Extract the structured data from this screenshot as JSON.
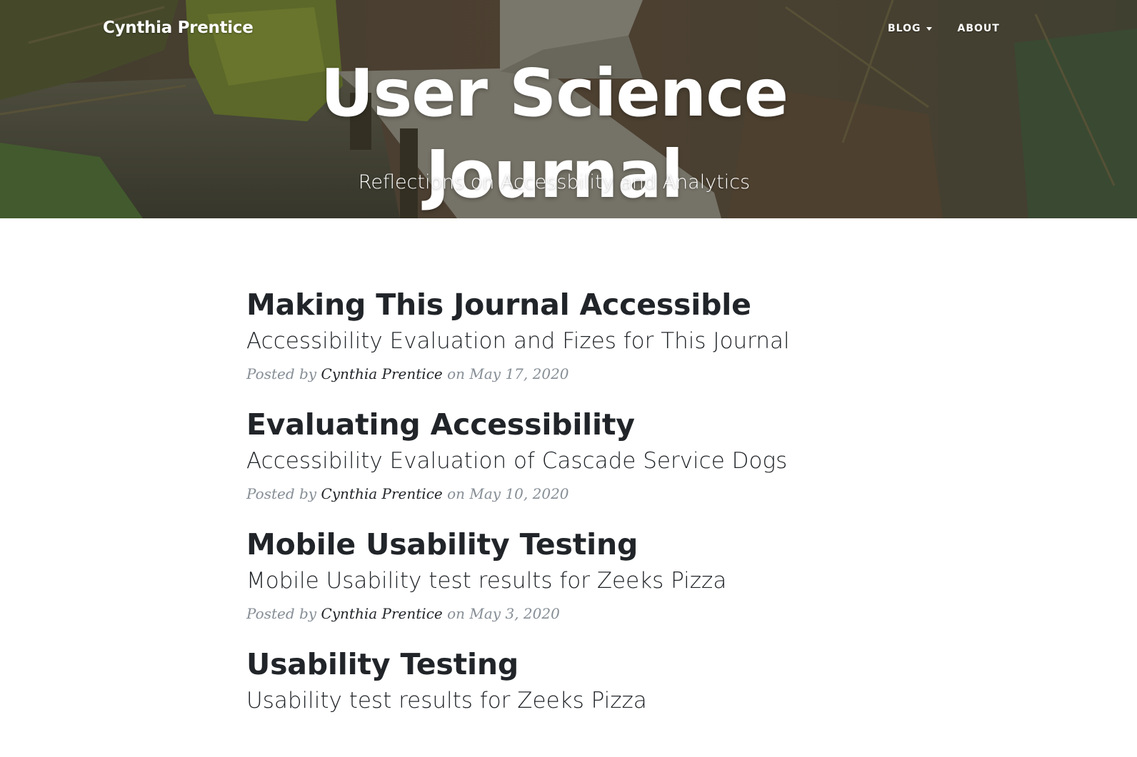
{
  "navbar": {
    "brand": "Cynthia Prentice",
    "items": [
      {
        "label": "BLOG",
        "has_dropdown": true
      },
      {
        "label": "ABOUT",
        "has_dropdown": false
      }
    ]
  },
  "header": {
    "title_line1": "User Science",
    "title_line2": "Journal",
    "subtitle": "Reflections on Accessbility and Analytics"
  },
  "posts": [
    {
      "title": "Making This Journal Accessible",
      "subtitle": "Accessibility Evaluation and Fizes for This Journal",
      "meta_prefix": "Posted by",
      "author": "Cynthia Prentice",
      "meta_on": "on",
      "date": "May 17, 2020"
    },
    {
      "title": "Evaluating Accessibility",
      "subtitle": "Accessibility Evaluation of Cascade Service Dogs",
      "meta_prefix": "Posted by",
      "author": "Cynthia Prentice",
      "meta_on": "on",
      "date": "May 10, 2020"
    },
    {
      "title": "Mobile Usability Testing",
      "subtitle": "Mobile Usability test results for Zeeks Pizza",
      "meta_prefix": "Posted by",
      "author": "Cynthia Prentice",
      "meta_on": "on",
      "date": "May 3, 2020"
    },
    {
      "title": "Usability Testing",
      "subtitle": "Usability test results for Zeeks Pizza"
    }
  ],
  "colors": {
    "heading_text": "#212529",
    "meta_text": "#868e96",
    "hero_text": "#ffffff"
  },
  "icons": {
    "blog_dropdown": "caret-down-icon"
  }
}
